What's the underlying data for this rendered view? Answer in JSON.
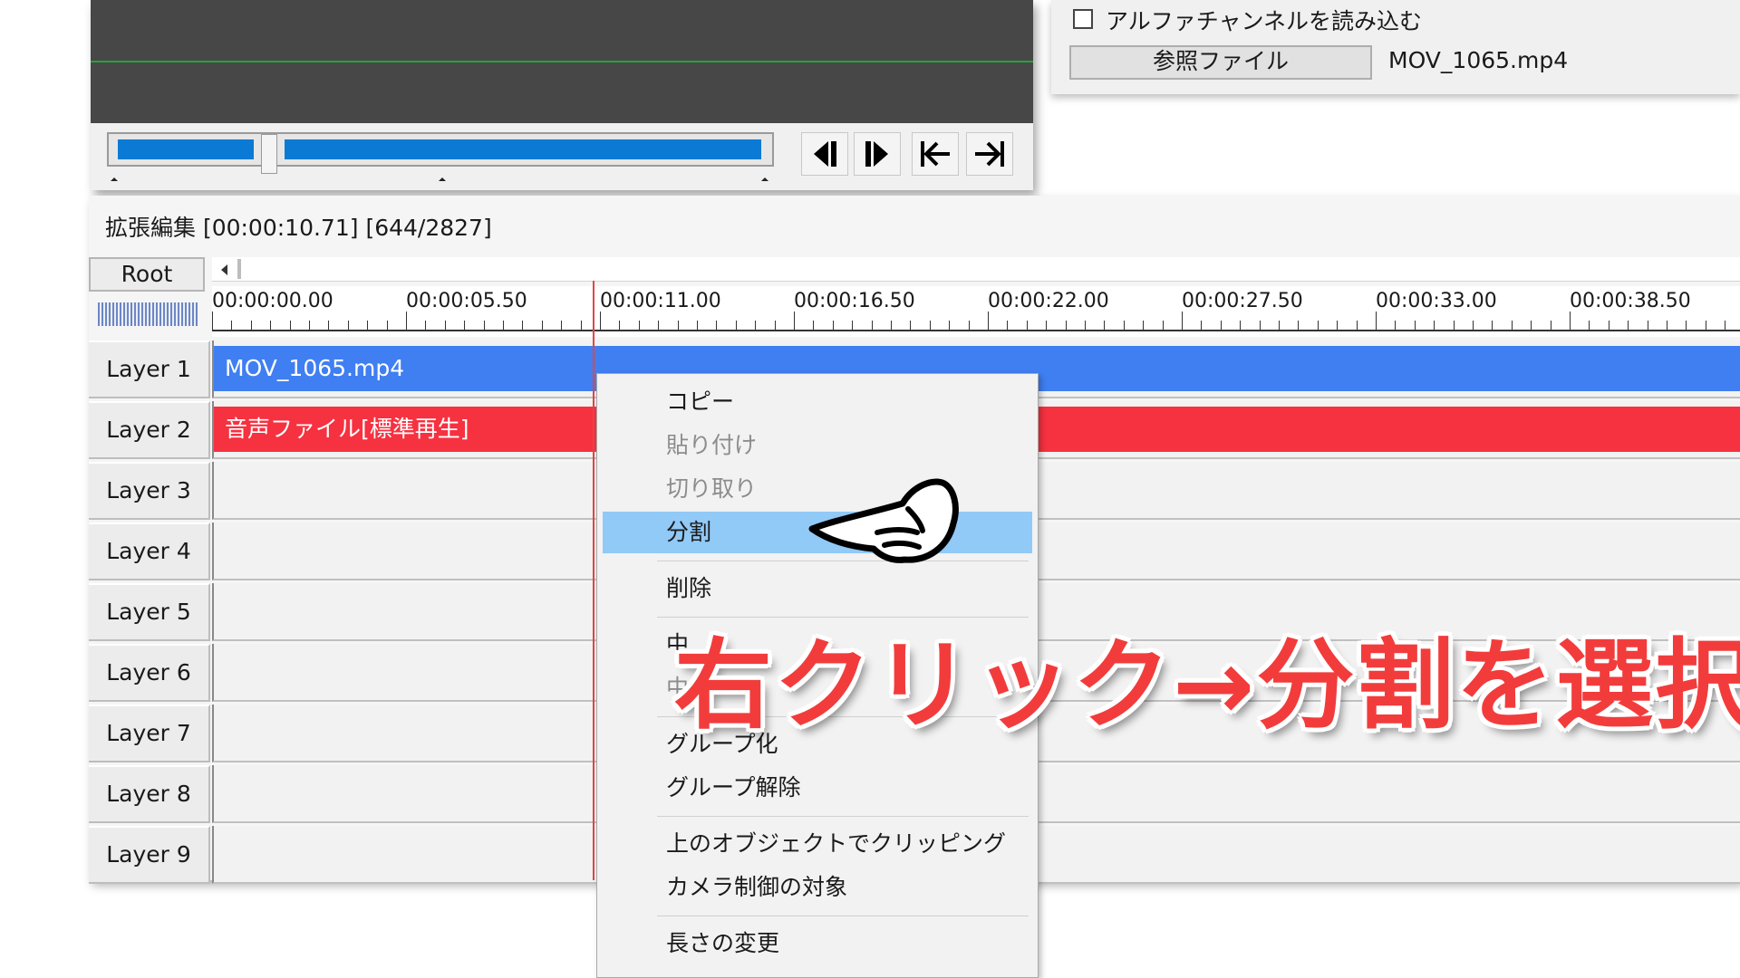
{
  "preview": {
    "controls": [
      "prev-frame",
      "next-frame",
      "go-start",
      "go-end"
    ],
    "seek_progress": 0.23
  },
  "panel": {
    "alpha_label": "アルファチャンネルを読み込む",
    "alpha_checked": false,
    "ref_button": "参照ファイル",
    "file_name": "MOV_1065.mp4"
  },
  "timeline": {
    "title": "拡張編集 [00:00:10.71] [644/2827]",
    "root_label": "Root",
    "ruler_labels": [
      "00:00:00.00",
      "00:00:05.50",
      "00:00:11.00",
      "00:00:16.50",
      "00:00:22.00",
      "00:00:27.50",
      "00:00:33.00",
      "00:00:38.50"
    ],
    "layers": [
      "Layer 1",
      "Layer 2",
      "Layer 3",
      "Layer 4",
      "Layer 5",
      "Layer 6",
      "Layer 7",
      "Layer 8",
      "Layer 9"
    ],
    "clips": {
      "video": "MOV_1065.mp4",
      "audio": "音声ファイル[標準再生]"
    }
  },
  "context_menu": {
    "items": [
      {
        "label": "コピー",
        "enabled": true
      },
      {
        "label": "貼り付け",
        "enabled": false
      },
      {
        "label": "切り取り",
        "enabled": false
      },
      {
        "label": "分割",
        "enabled": true,
        "highlighted": true
      },
      {
        "label": "削除",
        "enabled": true
      },
      {
        "label": "中",
        "enabled": true
      },
      {
        "label": "中",
        "enabled": false
      },
      {
        "label": "グループ化",
        "enabled": true
      },
      {
        "label": "グループ解除",
        "enabled": true
      },
      {
        "label": "上のオブジェクトでクリッピング",
        "enabled": true
      },
      {
        "label": "カメラ制御の対象",
        "enabled": true
      },
      {
        "label": "長さの変更",
        "enabled": true
      }
    ]
  },
  "overlay": {
    "text": "右クリック→分割を選択"
  },
  "colors": {
    "video_clip": "#3f7ff1",
    "audio_clip": "#f63140",
    "highlight": "#91c9f7",
    "overlay_text": "#f23c3c",
    "seek_fill": "#0a7ad4"
  }
}
